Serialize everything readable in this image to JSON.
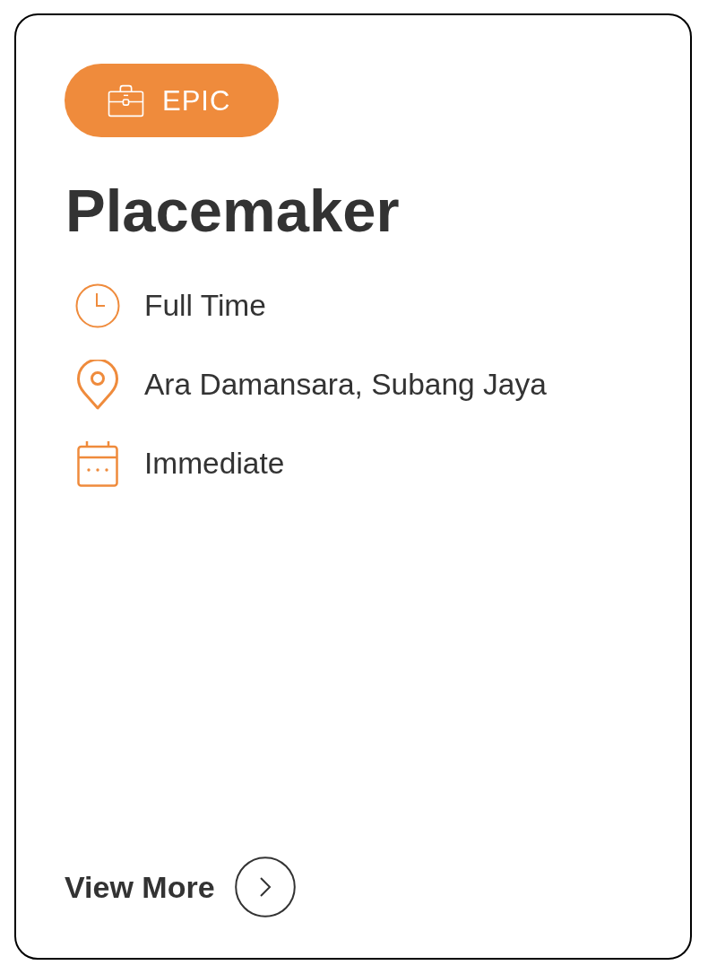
{
  "card": {
    "badge": {
      "label": "EPIC"
    },
    "title": "Placemaker",
    "details": [
      {
        "kind": "schedule",
        "text": "Full Time"
      },
      {
        "kind": "location",
        "text": "Ara Damansara, Subang Jaya"
      },
      {
        "kind": "start",
        "text": "Immediate"
      }
    ],
    "action": {
      "label": "View More"
    }
  }
}
